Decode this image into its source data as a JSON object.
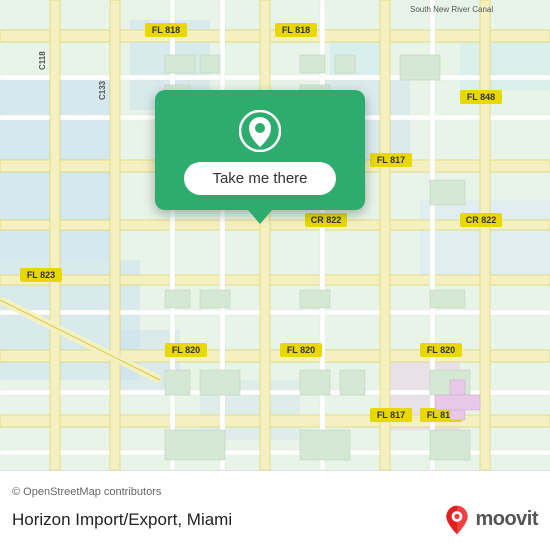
{
  "map": {
    "attribution": "© OpenStreetMap contributors",
    "background_color": "#e8f0e8"
  },
  "popup": {
    "button_label": "Take me there"
  },
  "bottom_bar": {
    "location_name": "Horizon Import/Export, Miami",
    "moovit_text": "moovit"
  }
}
